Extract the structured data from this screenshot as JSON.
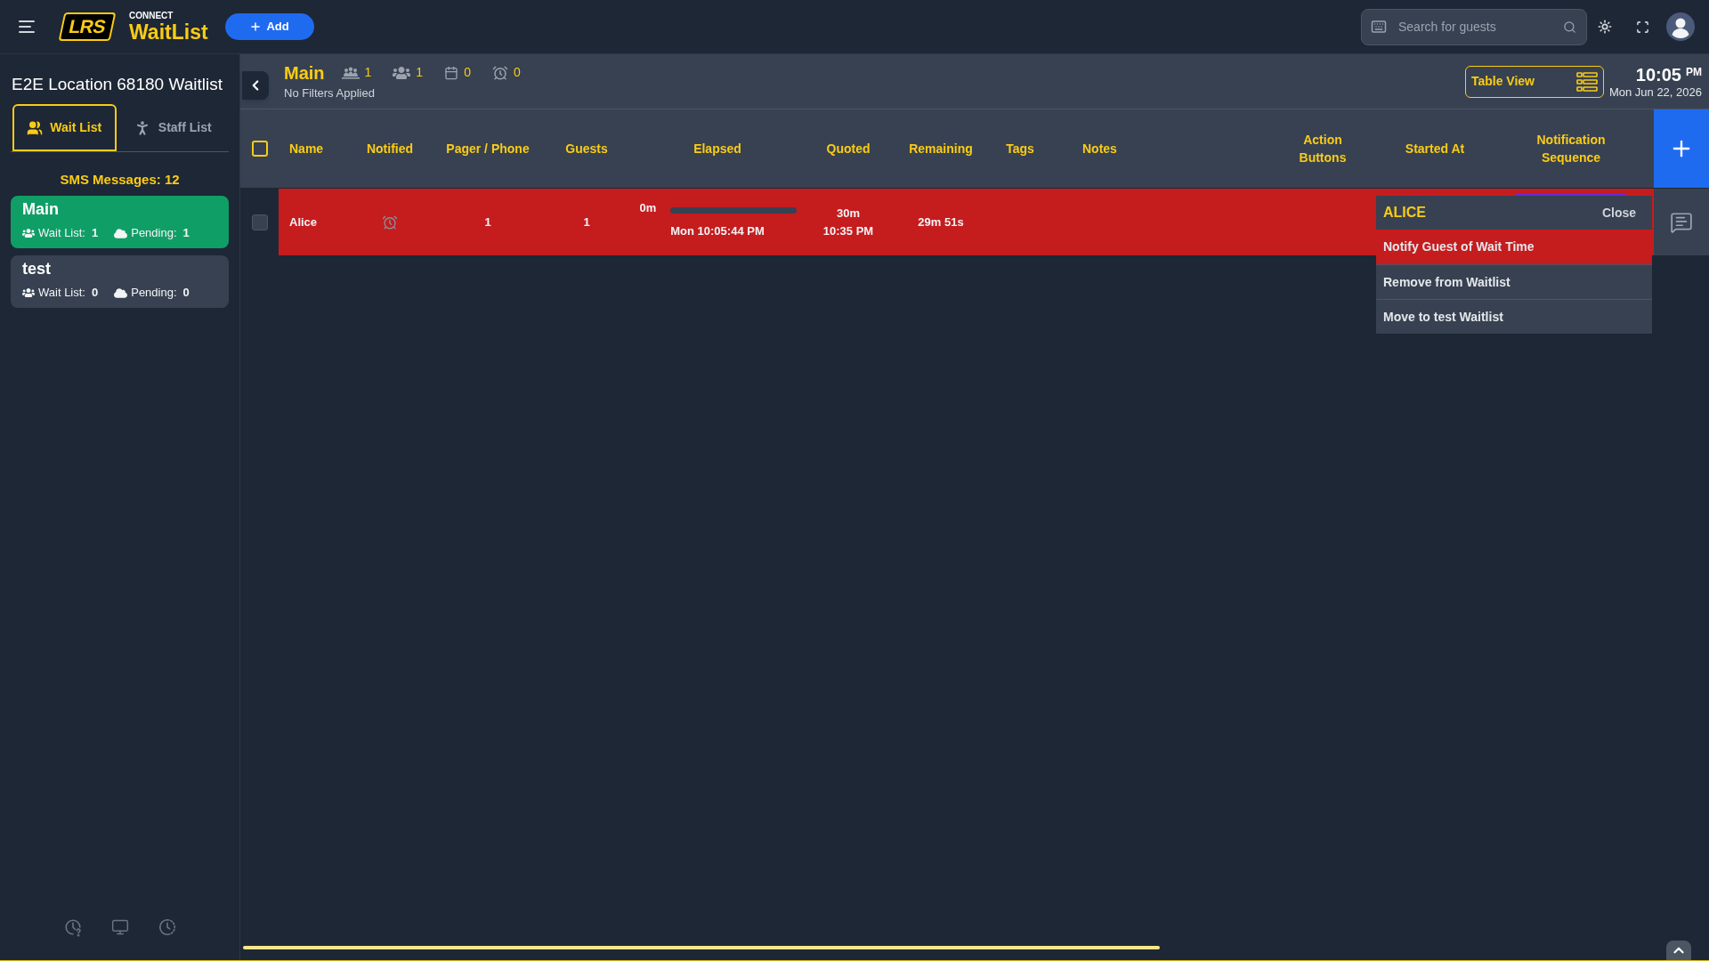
{
  "top_bar": {
    "logo": {
      "badge": "LRS",
      "overline": "CONNECT",
      "name": "WaitList"
    },
    "add_button": "Add",
    "search": {
      "placeholder": "Search for guests"
    }
  },
  "sidebar": {
    "title": "E2E Location 68180 Waitlist",
    "tabs": [
      {
        "kind": "group",
        "label": "Wait List",
        "selected": true
      },
      {
        "kind": "staff",
        "label": "Staff List",
        "selected": false
      }
    ],
    "sms": "SMS Messages: 12",
    "waitlists": [
      {
        "name": "Main",
        "selected": true,
        "wait_list_label": "Wait List:",
        "wait_list": "1",
        "pending_label": "Pending:",
        "pending": "1"
      },
      {
        "name": "test",
        "selected": false,
        "wait_list_label": "Wait List:",
        "wait_list": "0",
        "pending_label": "Pending:",
        "pending": "0"
      }
    ]
  },
  "header": {
    "title": "Main",
    "counts": [
      {
        "kind": "queue",
        "value": "1"
      },
      {
        "kind": "party",
        "value": "1"
      },
      {
        "kind": "calendar",
        "value": "0"
      },
      {
        "kind": "alarm",
        "value": "0"
      }
    ],
    "filters": "No Filters Applied",
    "view_button": "Table View",
    "time": "10:05",
    "meridiem": "PM",
    "date": "Mon Jun 22, 2026"
  },
  "table": {
    "select_all": {
      "checked": false
    },
    "columns": [
      "Name",
      "Notified",
      "Pager / Phone",
      "Guests",
      "Elapsed",
      "Quoted",
      "Remaining",
      "Tags",
      "Notes",
      "Action Buttons",
      "Started At",
      "Notification Sequence"
    ],
    "rows": [
      {
        "checked": false,
        "name": "Alice",
        "notified": false,
        "pager": "1",
        "guests": "1",
        "elapsed": {
          "value": "0m",
          "level": 0
        },
        "check_in": "Mon 10:05:44 PM",
        "quoted": "30m",
        "quoted_time": "10:35 PM",
        "remaining": "29m 51s"
      }
    ]
  },
  "popup": {
    "title": "ALICE",
    "close": "Close",
    "items": [
      {
        "label": "Notify Guest of Wait Time",
        "selected": true
      },
      {
        "label": "Remove from Waitlist",
        "selected": false
      },
      {
        "label": "Move to test Waitlist",
        "selected": false
      }
    ]
  }
}
